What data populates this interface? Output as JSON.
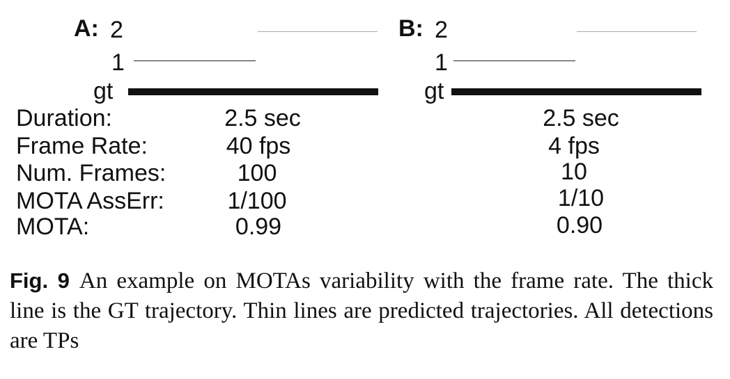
{
  "panels": [
    {
      "letter": "A:",
      "track_labels": [
        "2",
        "1",
        "gt"
      ],
      "values": {
        "duration": "2.5 sec",
        "frame_rate": "40 fps",
        "num_frames": "100",
        "mota_asserr": "1/100",
        "mota": "0.99"
      }
    },
    {
      "letter": "B:",
      "track_labels": [
        "2",
        "1",
        "gt"
      ],
      "values": {
        "duration": "2.5 sec",
        "frame_rate": "4 fps",
        "num_frames": "10",
        "mota_asserr": "1/10",
        "mota": "0.90"
      }
    }
  ],
  "row_labels": {
    "duration": "Duration:",
    "frame_rate": "Frame Rate:",
    "num_frames": "Num. Frames:",
    "mota_asserr": "MOTA AssErr:",
    "mota": "MOTA:"
  },
  "caption": {
    "label": "Fig. 9",
    "text": "An example on MOTAs variability with the frame rate. The thick line is the GT trajectory. Thin lines are predicted trajectories. All detections are TPs"
  }
}
